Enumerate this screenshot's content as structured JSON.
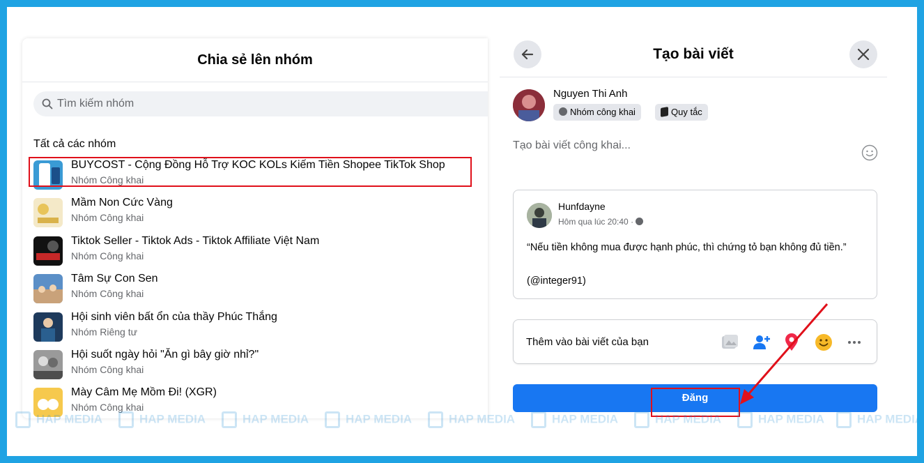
{
  "share_dialog": {
    "title": "Chia sẻ lên nhóm",
    "search_placeholder": "Tìm kiếm nhóm",
    "section_label": "Tất cả các nhóm",
    "groups": [
      {
        "name": "BUYCOST - Cộng Đồng Hỗ Trợ KOC KOLs Kiếm Tiền Shopee TikTok Shop",
        "privacy": "Nhóm Công khai"
      },
      {
        "name": "Mầm Non Cức Vàng",
        "privacy": "Nhóm Công khai"
      },
      {
        "name": "Tiktok Seller - Tiktok Ads - Tiktok Affiliate Việt Nam",
        "privacy": "Nhóm Công khai"
      },
      {
        "name": "Tâm Sự Con Sen",
        "privacy": "Nhóm Công khai"
      },
      {
        "name": "Hội sinh viên bất ổn của thầy Phúc Thắng",
        "privacy": "Nhóm Riêng tư"
      },
      {
        "name": "Hội suốt ngày hỏi \"Ăn gì bây giờ nhỉ?\"",
        "privacy": "Nhóm Công khai"
      },
      {
        "name": "Mày Câm Mẹ Mồm Đi! (XGR)",
        "privacy": "Nhóm Công khai"
      }
    ]
  },
  "create_post": {
    "title": "Tạo bài viết",
    "user_name": "Nguyen Thi Anh",
    "audience_chip": "Nhóm công khai",
    "rules_chip": "Quy tắc",
    "placeholder": "Tạo bài viết công khai...",
    "shared_post": {
      "author": "Hunfdayne",
      "time": "Hôm qua lúc 20:40 ·",
      "quote": "“Nếu tiền không mua được hạnh phúc, thì chứng tỏ bạn không đủ tiền.”",
      "handle": "(@integer91)"
    },
    "add_to_post_label": "Thêm vào bài viết của bạn",
    "post_button": "Đăng"
  },
  "watermark_text": "HAP MEDIA",
  "colors": {
    "frame": "#1fa3e3",
    "primary": "#1877f2",
    "highlight": "#e0101a"
  }
}
